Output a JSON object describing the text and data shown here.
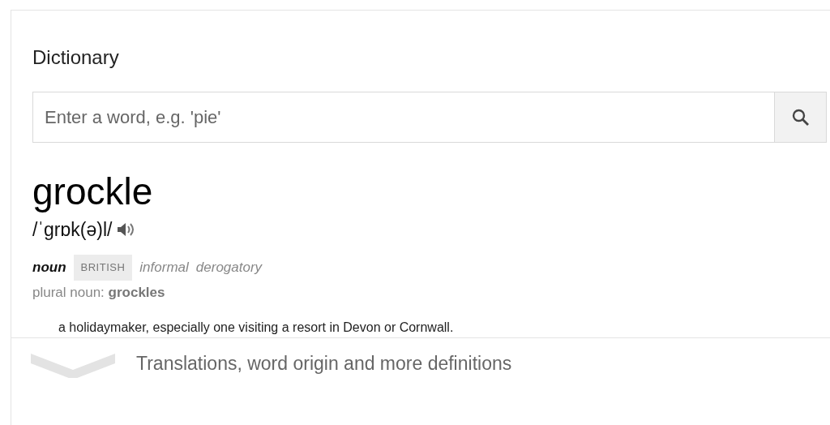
{
  "title": "Dictionary",
  "search": {
    "placeholder": "Enter a word, e.g. 'pie'"
  },
  "entry": {
    "headword": "grockle",
    "pronunciation": "/ˈɡrɒk(ə)l/",
    "part_of_speech": "noun",
    "region": "BRITISH",
    "registers": [
      "informal",
      "derogatory"
    ],
    "plural_label": "plural noun:",
    "plural": "grockles",
    "definitions": [
      "a holidaymaker, especially one visiting a resort in Devon or Cornwall."
    ]
  },
  "more": {
    "label": "Translations, word origin and more definitions"
  }
}
